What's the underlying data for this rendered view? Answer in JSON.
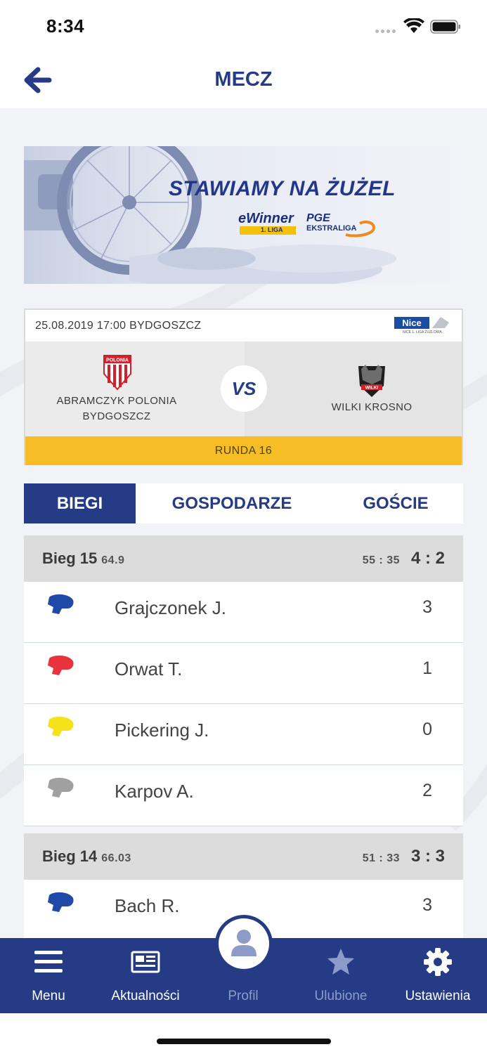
{
  "status_bar": {
    "time": "8:34"
  },
  "navbar": {
    "title": "MECZ",
    "back_icon": "arrow-left-icon"
  },
  "banner": {
    "headline": "STAWIAMY NA ŻUŻEL",
    "logo1_text": "eWinner",
    "logo1_sub": "1. LIGA",
    "logo2_text1": "PGE",
    "logo2_text2": "EKSTRALIGA"
  },
  "match": {
    "datetime": "25.08.2019 17:00 BYDGOSZCZ",
    "sponsor_logo": "Nice",
    "sponsor_sub": "NICE 1. LIGA ŻUŻLOWA",
    "home_team": "ABRAMCZYK POLONIA BYDGOSZCZ",
    "home_crest_text": "POLONIA",
    "vs": "VS",
    "away_team": "WILKI KROSNO",
    "away_crest_text": "WILKI",
    "round": "RUNDA 16"
  },
  "tabs": [
    {
      "label": "BIEGI",
      "active": true
    },
    {
      "label": "GOSPODARZE",
      "active": false
    },
    {
      "label": "GOŚCIE",
      "active": false
    }
  ],
  "heats": [
    {
      "name": "Bieg 15",
      "time": "64.9",
      "total": "55 : 35",
      "score": "4 : 2",
      "riders": [
        {
          "name": "Grajczonek J.",
          "points": "3",
          "helmet_color": "#1f4aa8"
        },
        {
          "name": "Orwat T.",
          "points": "1",
          "helmet_color": "#e8323c"
        },
        {
          "name": "Pickering J.",
          "points": "0",
          "helmet_color": "#f5e21a"
        },
        {
          "name": "Karpov A.",
          "points": "2",
          "helmet_color": "#a0a0a0"
        }
      ]
    },
    {
      "name": "Bieg 14",
      "time": "66.03",
      "total": "51 : 33",
      "score": "3 : 3",
      "riders": [
        {
          "name": "Bach R.",
          "points": "3",
          "helmet_color": "#1f4aa8"
        }
      ]
    }
  ],
  "tabbar": {
    "items": [
      {
        "label": "Menu",
        "icon": "hamburger-icon"
      },
      {
        "label": "Aktualności",
        "icon": "newspaper-icon"
      },
      {
        "label": "Profil",
        "icon": "user-icon"
      },
      {
        "label": "Ulubione",
        "icon": "star-icon"
      },
      {
        "label": "Ustawienia",
        "icon": "gear-icon"
      }
    ]
  },
  "colors": {
    "primary": "#263b85",
    "round_bar": "#f6be24",
    "heat_header": "#dcdcdc"
  }
}
